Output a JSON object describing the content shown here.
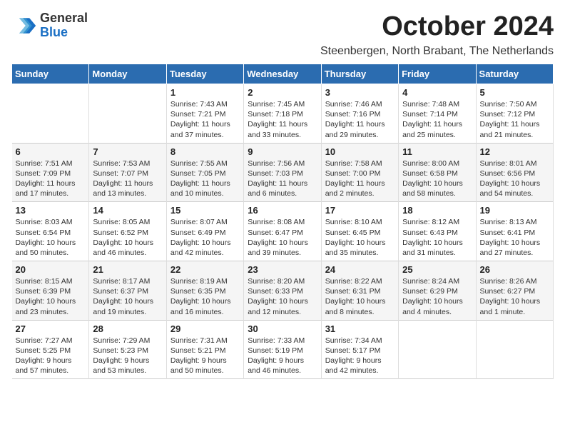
{
  "logo": {
    "line1": "General",
    "line2": "Blue"
  },
  "title": "October 2024",
  "subtitle": "Steenbergen, North Brabant, The Netherlands",
  "header_color": "#2b6cb0",
  "days_of_week": [
    "Sunday",
    "Monday",
    "Tuesday",
    "Wednesday",
    "Thursday",
    "Friday",
    "Saturday"
  ],
  "weeks": [
    [
      {
        "day": "",
        "sunrise": "",
        "sunset": "",
        "daylight": ""
      },
      {
        "day": "",
        "sunrise": "",
        "sunset": "",
        "daylight": ""
      },
      {
        "day": "1",
        "sunrise": "Sunrise: 7:43 AM",
        "sunset": "Sunset: 7:21 PM",
        "daylight": "Daylight: 11 hours and 37 minutes."
      },
      {
        "day": "2",
        "sunrise": "Sunrise: 7:45 AM",
        "sunset": "Sunset: 7:18 PM",
        "daylight": "Daylight: 11 hours and 33 minutes."
      },
      {
        "day": "3",
        "sunrise": "Sunrise: 7:46 AM",
        "sunset": "Sunset: 7:16 PM",
        "daylight": "Daylight: 11 hours and 29 minutes."
      },
      {
        "day": "4",
        "sunrise": "Sunrise: 7:48 AM",
        "sunset": "Sunset: 7:14 PM",
        "daylight": "Daylight: 11 hours and 25 minutes."
      },
      {
        "day": "5",
        "sunrise": "Sunrise: 7:50 AM",
        "sunset": "Sunset: 7:12 PM",
        "daylight": "Daylight: 11 hours and 21 minutes."
      }
    ],
    [
      {
        "day": "6",
        "sunrise": "Sunrise: 7:51 AM",
        "sunset": "Sunset: 7:09 PM",
        "daylight": "Daylight: 11 hours and 17 minutes."
      },
      {
        "day": "7",
        "sunrise": "Sunrise: 7:53 AM",
        "sunset": "Sunset: 7:07 PM",
        "daylight": "Daylight: 11 hours and 13 minutes."
      },
      {
        "day": "8",
        "sunrise": "Sunrise: 7:55 AM",
        "sunset": "Sunset: 7:05 PM",
        "daylight": "Daylight: 11 hours and 10 minutes."
      },
      {
        "day": "9",
        "sunrise": "Sunrise: 7:56 AM",
        "sunset": "Sunset: 7:03 PM",
        "daylight": "Daylight: 11 hours and 6 minutes."
      },
      {
        "day": "10",
        "sunrise": "Sunrise: 7:58 AM",
        "sunset": "Sunset: 7:00 PM",
        "daylight": "Daylight: 11 hours and 2 minutes."
      },
      {
        "day": "11",
        "sunrise": "Sunrise: 8:00 AM",
        "sunset": "Sunset: 6:58 PM",
        "daylight": "Daylight: 10 hours and 58 minutes."
      },
      {
        "day": "12",
        "sunrise": "Sunrise: 8:01 AM",
        "sunset": "Sunset: 6:56 PM",
        "daylight": "Daylight: 10 hours and 54 minutes."
      }
    ],
    [
      {
        "day": "13",
        "sunrise": "Sunrise: 8:03 AM",
        "sunset": "Sunset: 6:54 PM",
        "daylight": "Daylight: 10 hours and 50 minutes."
      },
      {
        "day": "14",
        "sunrise": "Sunrise: 8:05 AM",
        "sunset": "Sunset: 6:52 PM",
        "daylight": "Daylight: 10 hours and 46 minutes."
      },
      {
        "day": "15",
        "sunrise": "Sunrise: 8:07 AM",
        "sunset": "Sunset: 6:49 PM",
        "daylight": "Daylight: 10 hours and 42 minutes."
      },
      {
        "day": "16",
        "sunrise": "Sunrise: 8:08 AM",
        "sunset": "Sunset: 6:47 PM",
        "daylight": "Daylight: 10 hours and 39 minutes."
      },
      {
        "day": "17",
        "sunrise": "Sunrise: 8:10 AM",
        "sunset": "Sunset: 6:45 PM",
        "daylight": "Daylight: 10 hours and 35 minutes."
      },
      {
        "day": "18",
        "sunrise": "Sunrise: 8:12 AM",
        "sunset": "Sunset: 6:43 PM",
        "daylight": "Daylight: 10 hours and 31 minutes."
      },
      {
        "day": "19",
        "sunrise": "Sunrise: 8:13 AM",
        "sunset": "Sunset: 6:41 PM",
        "daylight": "Daylight: 10 hours and 27 minutes."
      }
    ],
    [
      {
        "day": "20",
        "sunrise": "Sunrise: 8:15 AM",
        "sunset": "Sunset: 6:39 PM",
        "daylight": "Daylight: 10 hours and 23 minutes."
      },
      {
        "day": "21",
        "sunrise": "Sunrise: 8:17 AM",
        "sunset": "Sunset: 6:37 PM",
        "daylight": "Daylight: 10 hours and 19 minutes."
      },
      {
        "day": "22",
        "sunrise": "Sunrise: 8:19 AM",
        "sunset": "Sunset: 6:35 PM",
        "daylight": "Daylight: 10 hours and 16 minutes."
      },
      {
        "day": "23",
        "sunrise": "Sunrise: 8:20 AM",
        "sunset": "Sunset: 6:33 PM",
        "daylight": "Daylight: 10 hours and 12 minutes."
      },
      {
        "day": "24",
        "sunrise": "Sunrise: 8:22 AM",
        "sunset": "Sunset: 6:31 PM",
        "daylight": "Daylight: 10 hours and 8 minutes."
      },
      {
        "day": "25",
        "sunrise": "Sunrise: 8:24 AM",
        "sunset": "Sunset: 6:29 PM",
        "daylight": "Daylight: 10 hours and 4 minutes."
      },
      {
        "day": "26",
        "sunrise": "Sunrise: 8:26 AM",
        "sunset": "Sunset: 6:27 PM",
        "daylight": "Daylight: 10 hours and 1 minute."
      }
    ],
    [
      {
        "day": "27",
        "sunrise": "Sunrise: 7:27 AM",
        "sunset": "Sunset: 5:25 PM",
        "daylight": "Daylight: 9 hours and 57 minutes."
      },
      {
        "day": "28",
        "sunrise": "Sunrise: 7:29 AM",
        "sunset": "Sunset: 5:23 PM",
        "daylight": "Daylight: 9 hours and 53 minutes."
      },
      {
        "day": "29",
        "sunrise": "Sunrise: 7:31 AM",
        "sunset": "Sunset: 5:21 PM",
        "daylight": "Daylight: 9 hours and 50 minutes."
      },
      {
        "day": "30",
        "sunrise": "Sunrise: 7:33 AM",
        "sunset": "Sunset: 5:19 PM",
        "daylight": "Daylight: 9 hours and 46 minutes."
      },
      {
        "day": "31",
        "sunrise": "Sunrise: 7:34 AM",
        "sunset": "Sunset: 5:17 PM",
        "daylight": "Daylight: 9 hours and 42 minutes."
      },
      {
        "day": "",
        "sunrise": "",
        "sunset": "",
        "daylight": ""
      },
      {
        "day": "",
        "sunrise": "",
        "sunset": "",
        "daylight": ""
      }
    ]
  ]
}
